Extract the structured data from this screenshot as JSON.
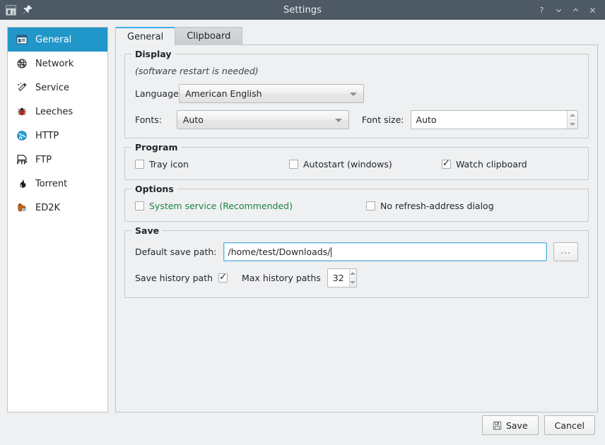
{
  "window": {
    "title": "Settings",
    "app_icon": "window-icon",
    "pin_icon": "pin-icon",
    "controls": [
      {
        "name": "help-button",
        "glyph": "?",
        "icon": "question-mark-icon"
      },
      {
        "name": "minimize-button",
        "glyph": "⌄",
        "icon": "chevron-down-icon"
      },
      {
        "name": "maximize-button",
        "glyph": "⌃",
        "icon": "chevron-up-icon"
      },
      {
        "name": "close-button",
        "glyph": "✕",
        "icon": "close-icon"
      }
    ]
  },
  "sidebar": {
    "items": [
      {
        "label": "General",
        "icon": "document-settings-icon",
        "selected": true
      },
      {
        "label": "Network",
        "icon": "globe-crossed-icon",
        "selected": false
      },
      {
        "label": "Service",
        "icon": "magic-wand-icon",
        "selected": false
      },
      {
        "label": "Leeches",
        "icon": "ladybug-icon",
        "selected": false
      },
      {
        "label": "HTTP",
        "icon": "globe-icon",
        "selected": false
      },
      {
        "label": "FTP",
        "icon": "ftp-file-icon",
        "selected": false
      },
      {
        "label": "Torrent",
        "icon": "flame-icon",
        "selected": false
      },
      {
        "label": "ED2K",
        "icon": "donkey-icon",
        "selected": false
      }
    ]
  },
  "tabs": [
    {
      "label": "General",
      "active": true
    },
    {
      "label": "Clipboard",
      "active": false
    }
  ],
  "groups": {
    "display": {
      "legend": "Display",
      "note": "(software restart is needed)",
      "language_label": "Language:",
      "language_value": "American English",
      "fonts_label": "Fonts:",
      "fonts_value": "Auto",
      "fontsize_label": "Font size:",
      "fontsize_value": "Auto"
    },
    "program": {
      "legend": "Program",
      "tray_icon_label": "Tray icon",
      "tray_icon_checked": false,
      "autostart_label": "Autostart (windows)",
      "autostart_checked": false,
      "watch_clipboard_label": "Watch clipboard",
      "watch_clipboard_checked": true
    },
    "options": {
      "legend": "Options",
      "system_service_label": "System service (Recommended)",
      "system_service_checked": false,
      "system_service_color": "#1d8045",
      "no_refresh_label": "No refresh-address dialog",
      "no_refresh_checked": false
    },
    "save": {
      "legend": "Save",
      "default_path_label": "Default save path:",
      "default_path_value": "/home/test/Downloads/",
      "browse_label": "...",
      "save_history_label": "Save history path",
      "save_history_checked": true,
      "max_history_label": "Max history paths",
      "max_history_value": "32"
    }
  },
  "footer": {
    "save_label": "Save",
    "save_icon": "floppy-disk-icon",
    "cancel_label": "Cancel"
  },
  "colors": {
    "titlebar": "#4d5a65",
    "accent": "#2196c9",
    "tab_accent": "#3daee9",
    "background": "#eff0f1",
    "green_text": "#1d8045"
  }
}
